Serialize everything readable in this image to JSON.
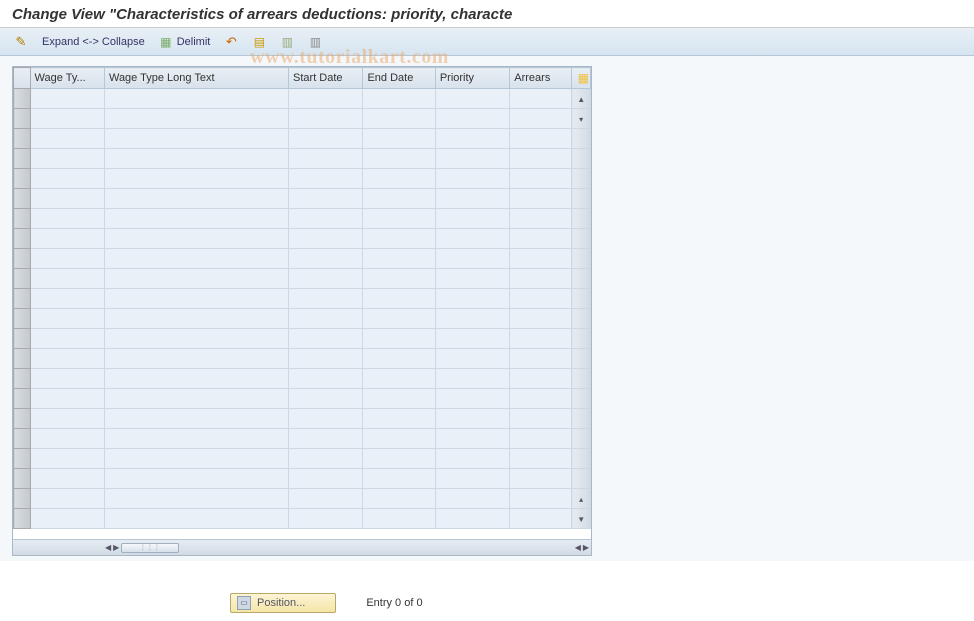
{
  "watermark": "www.tutorialkart.com",
  "title": "Change View \"Characteristics of arrears deductions: priority, characte",
  "toolbar": {
    "expand_collapse": "Expand <-> Collapse",
    "delimit": "Delimit"
  },
  "grid": {
    "columns": [
      "Wage Ty...",
      "Wage Type Long Text",
      "Start Date",
      "End Date",
      "Priority",
      "Arrears"
    ],
    "row_count": 22
  },
  "footer": {
    "position_label": "Position...",
    "entry_text": "Entry 0 of 0"
  }
}
